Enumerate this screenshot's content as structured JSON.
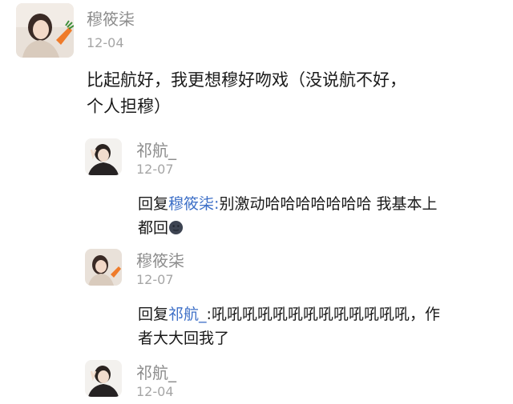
{
  "main_comment": {
    "username": "穆筱柒",
    "date": "12-04",
    "avatar_icon": "girl-with-carrot-avatar",
    "text_line1": "比起航好，我更想穆好吻戏（没说航不好，",
    "text_line2": "个人担穆）"
  },
  "replies": [
    {
      "username": "祁航_",
      "date": "12-07",
      "avatar_icon": "girl-peace-sign-avatar",
      "prefix": "回复",
      "mention": "穆筱柒",
      "sep": ":",
      "text_line1_rest": "别激动哈哈哈哈哈哈哈 我基本上",
      "text_line2": "都回",
      "emoji": "new-moon-face-emoji"
    },
    {
      "username": "穆筱柒",
      "date": "12-07",
      "avatar_icon": "girl-with-carrot-avatar",
      "prefix": "回复",
      "mention": "祁航_",
      "sep": ":",
      "text_line1_rest": "吼吼吼吼吼吼吼吼吼吼吼吼吼，作",
      "text_line2": "者大大回我了"
    },
    {
      "username": "祁航_",
      "date": "12-04",
      "avatar_icon": "girl-peace-sign-avatar"
    }
  ],
  "colors": {
    "mention": "#3d6fc7",
    "username": "#8c8c8c",
    "timestamp": "#a6a6a6",
    "text": "#1a1a1a"
  }
}
